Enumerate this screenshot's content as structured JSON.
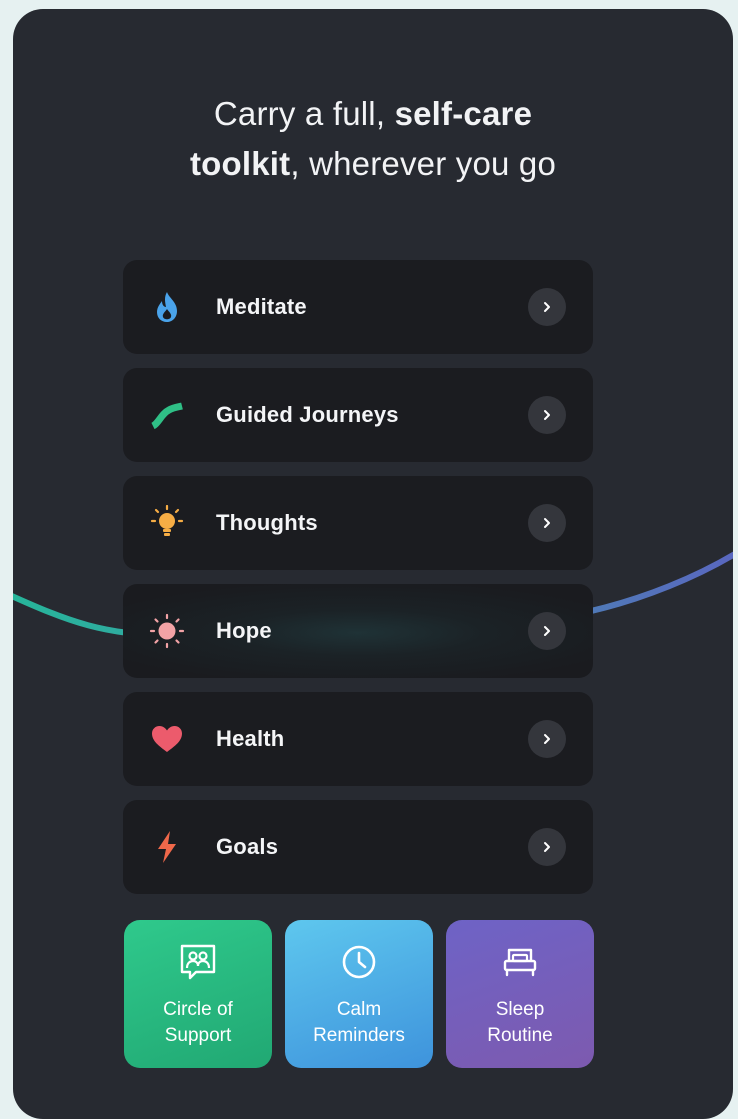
{
  "headline": {
    "line1_pre": "Carry a full, ",
    "line1_bold": "self-care",
    "line2_bold": "toolkit",
    "line2_post": ", wherever you go"
  },
  "rows": [
    {
      "label": "Meditate",
      "icon": "flame-icon",
      "color": "#4aa3ea"
    },
    {
      "label": "Guided Journeys",
      "icon": "wave-stroke-icon",
      "color": "#2fbf86"
    },
    {
      "label": "Thoughts",
      "icon": "lightbulb-icon",
      "color": "#f6ad45"
    },
    {
      "label": "Hope",
      "icon": "sun-icon",
      "color": "#f3a3a6"
    },
    {
      "label": "Health",
      "icon": "heart-icon",
      "color": "#ec5b6c"
    },
    {
      "label": "Goals",
      "icon": "lightning-icon",
      "color": "#f0684a"
    }
  ],
  "tiles": [
    {
      "label": "Circle of\nSupport",
      "icon": "group-photo-icon"
    },
    {
      "label": "Calm\nReminders",
      "icon": "clock-icon"
    },
    {
      "label": "Sleep\nRoutine",
      "icon": "bed-icon"
    }
  ],
  "colors": {
    "background": "#e6f1f1",
    "panel": "#272a31",
    "row": "#1b1c20",
    "wave_left": "#26b69a",
    "wave_right": "#5a66c0"
  }
}
